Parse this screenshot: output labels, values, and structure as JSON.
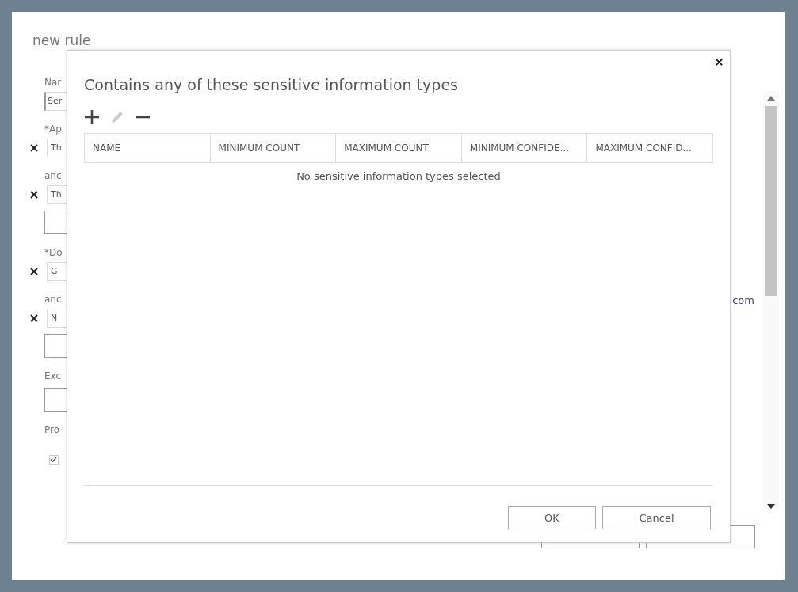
{
  "background": {
    "title": "new rule",
    "rows": [
      {
        "kind": "label",
        "text": "Nar"
      },
      {
        "kind": "field",
        "value": "Ser"
      },
      {
        "kind": "label",
        "text": "*Ap"
      },
      {
        "kind": "removable",
        "value": "Th"
      },
      {
        "kind": "label",
        "text": "anc"
      },
      {
        "kind": "removable",
        "value": "Th"
      },
      {
        "kind": "box"
      },
      {
        "kind": "label",
        "text": "*Do"
      },
      {
        "kind": "removable",
        "value": "G"
      },
      {
        "kind": "label",
        "text": "anc"
      },
      {
        "kind": "removable",
        "value": "N"
      },
      {
        "kind": "box"
      },
      {
        "kind": "label",
        "text": "Exc"
      },
      {
        "kind": "box"
      },
      {
        "kind": "label",
        "text": "Pro"
      },
      {
        "kind": "checkbox",
        "checked": true
      }
    ],
    "link": ".com"
  },
  "dialog": {
    "title": "Contains any of these sensitive information types",
    "tools": [
      {
        "kind": "add",
        "disabled": false
      },
      {
        "kind": "edit",
        "disabled": true
      },
      {
        "kind": "remove",
        "disabled": false
      }
    ],
    "columns": [
      "NAME",
      "MINIMUM COUNT",
      "MAXIMUM COUNT",
      "MINIMUM CONFIDE...",
      "MAXIMUM CONFID..."
    ],
    "empty_message": "No sensitive information types selected",
    "buttons": [
      "OK",
      "Cancel"
    ]
  }
}
